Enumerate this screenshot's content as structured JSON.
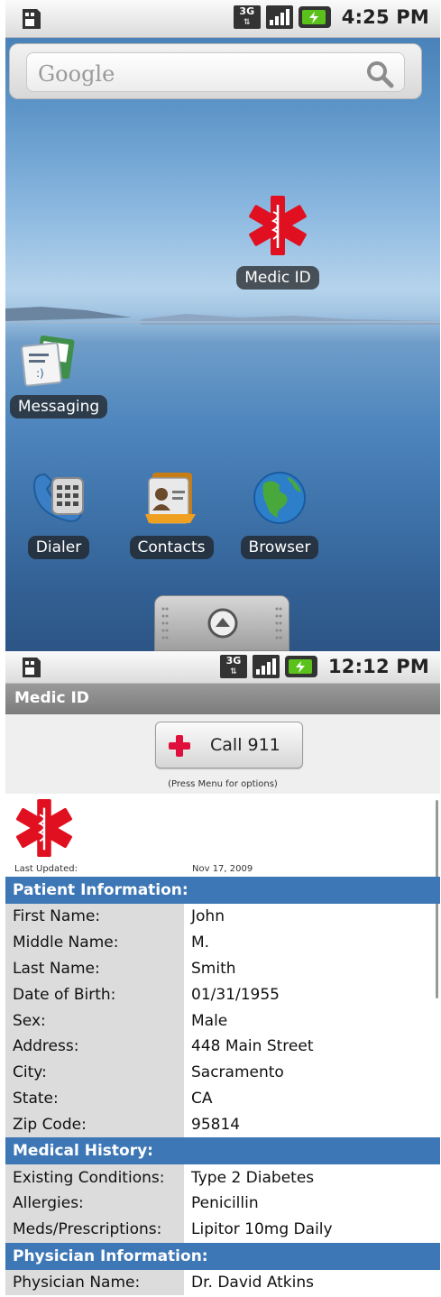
{
  "home": {
    "status": {
      "time": "4:25 PM",
      "network": "3G"
    },
    "search": {
      "placeholder": "Google"
    },
    "apps": [
      {
        "label": "Medic ID",
        "icon": "medic-star-of-life-icon"
      },
      {
        "label": "Messaging",
        "icon": "messaging-icon"
      },
      {
        "label": "Dialer",
        "icon": "phone-icon"
      },
      {
        "label": "Contacts",
        "icon": "contacts-icon"
      },
      {
        "label": "Browser",
        "icon": "globe-icon"
      }
    ]
  },
  "medic": {
    "status": {
      "time": "12:12 PM",
      "network": "3G"
    },
    "title": "Medic ID",
    "call_button": "Call 911",
    "hint": "(Press Menu for options)",
    "last_updated_label": "Last Updated:",
    "last_updated_value": "Nov 17, 2009",
    "sections": {
      "patient": "Patient Information:",
      "history": "Medical History:",
      "physician": "Physician Information:"
    },
    "patient_rows": [
      {
        "k": "First Name:",
        "v": "John"
      },
      {
        "k": "Middle Name:",
        "v": "M."
      },
      {
        "k": "Last Name:",
        "v": "Smith"
      },
      {
        "k": "Date of Birth:",
        "v": "01/31/1955"
      },
      {
        "k": "Sex:",
        "v": "Male"
      },
      {
        "k": "Address:",
        "v": "448 Main Street"
      },
      {
        "k": "City:",
        "v": "Sacramento"
      },
      {
        "k": "State:",
        "v": "CA"
      },
      {
        "k": "Zip Code:",
        "v": "95814"
      }
    ],
    "history_rows": [
      {
        "k": "Existing Conditions:",
        "v": "Type 2 Diabetes"
      },
      {
        "k": "Allergies:",
        "v": "Penicillin"
      },
      {
        "k": "Meds/Prescriptions:",
        "v": "Lipitor 10mg Daily"
      }
    ],
    "physician_rows": [
      {
        "k": "Physician Name:",
        "v": "Dr. David Atkins"
      }
    ]
  },
  "colors": {
    "section_blue": "#3d77b5",
    "label_gray": "#dcdcdc",
    "medic_red": "#e01020",
    "titlebar_gray": "#8a8a8a"
  }
}
